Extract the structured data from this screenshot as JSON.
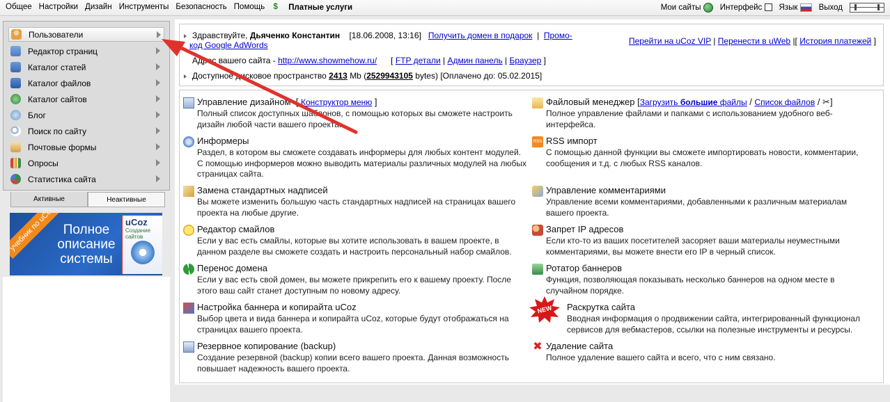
{
  "topbar": {
    "menu": [
      "Общее",
      "Настройки",
      "Дизайн",
      "Инструменты",
      "Безопасность",
      "Помощь"
    ],
    "paid_label": "Платные услуги",
    "right": {
      "my_sites": "Мои сайты",
      "interface": "Интерфейс",
      "language": "Язык",
      "logout": "Выход"
    }
  },
  "sidebar": {
    "items": [
      {
        "label": "Пользователи",
        "icon": "user-icon",
        "color": "#e8a040"
      },
      {
        "label": "Редактор страниц",
        "icon": "page-editor-icon",
        "color": "#4a7ac8"
      },
      {
        "label": "Каталог статей",
        "icon": "articles-icon",
        "color": "#3a6ab0"
      },
      {
        "label": "Каталог файлов",
        "icon": "files-icon",
        "color": "#2a5aa8"
      },
      {
        "label": "Каталог сайтов",
        "icon": "sites-icon",
        "color": "#2e8a3a"
      },
      {
        "label": "Блог",
        "icon": "blog-icon",
        "color": "#6a9ad0"
      },
      {
        "label": "Поиск по сайту",
        "icon": "search-icon",
        "color": "#7a9ac8"
      },
      {
        "label": "Почтовые формы",
        "icon": "mail-icon",
        "color": "#d8a040"
      },
      {
        "label": "Опросы",
        "icon": "poll-icon",
        "color": "#c84a3a"
      },
      {
        "label": "Статистика сайта",
        "icon": "stats-icon",
        "color": "#3a8a4a"
      }
    ],
    "tabs": {
      "active": "Активные",
      "inactive": "Неактивные"
    },
    "banner": {
      "ribbon": "учебник по uCoz",
      "line1": "Полное",
      "line2": "описание",
      "line3": "системы",
      "brand": "uCoz",
      "brand_sub": "Создание сайтов"
    }
  },
  "info": {
    "greeting": "Здравствуйте,",
    "username": "Дьяченко Константин",
    "datetime": "[18.06.2008, 13:16]",
    "domain_gift": "Получить домен в подарок",
    "promo1": "Промо-",
    "promo2": "код Google AdWords",
    "address_label": "Адрес вашего сайта -",
    "address_url": "http://www.showmehow.ru/",
    "ftp": "FTP детали",
    "admin": "Админ панель",
    "browser": "Браузер",
    "disk_label": "Доступное дисковое пространство",
    "disk_mb": "2413",
    "mb": "Mb",
    "disk_bytes": "2529943105",
    "bytes": "bytes",
    "paid_until": "[Оплачено до: 05.02.2015]",
    "vip": "Перейти на uCoz VIP",
    "transfer": "Перенести в uWeb",
    "history": "История платежей"
  },
  "modules_left": [
    {
      "title": "Управление дизайном",
      "link": "Конструктор меню",
      "desc": "Полный список доступных шаблонов, с помощью которых вы сможете настроить дизайн любой части вашего проекта.",
      "icon": "design-icon"
    },
    {
      "title": "Информеры",
      "desc": "Раздел, в котором вы сможете создавать информеры для любых контент модулей. С помощью информеров можно выводить материалы различных модулей на любых страницах сайта.",
      "icon": "informer-icon"
    },
    {
      "title": "Замена стандартных надписей",
      "desc": "Вы можете изменить большую часть стандартных надписей на страницах вашего проекта на любые другие.",
      "icon": "replace-text-icon"
    },
    {
      "title": "Редактор смайлов",
      "desc": "Если у вас есть смайлы, которые вы хотите использовать в вашем проекте, в данном разделе вы сможете создать и настроить персональный набор смайлов.",
      "icon": "smiley-icon"
    },
    {
      "title": "Перенос домена",
      "desc": "Если у вас есть свой домен, вы можете прикрепить его к вашему проекту. После этого ваш сайт станет доступным по новому адресу.",
      "icon": "domain-transfer-icon"
    },
    {
      "title": "Настройка баннера и копирайта uCoz",
      "desc": "Выбор цвета и вида баннера и копирайта uCoz, которые будут отображаться на страницах вашего проекта.",
      "icon": "banner-settings-icon"
    },
    {
      "title": "Резервное копирование (backup)",
      "desc": "Создание резервной (backup) копии всего вашего проекта. Данная возможность повышает надежность вашего проекта.",
      "icon": "backup-icon"
    }
  ],
  "modules_right": [
    {
      "title": "Файловый менеджер",
      "desc": "Полное управление файлами и папками с использованием удобного веб-интерфейса.",
      "icon": "folder-icon"
    },
    {
      "title": "RSS импорт",
      "desc": "С помощью данной функции вы сможете импортировать новости, комментарии, сообщения и т.д. с любых RSS каналов.",
      "icon": "rss-icon"
    },
    {
      "title": "Управление комментариями",
      "desc": "Управление всеми комментариями, добавленными к различным материалам вашего проекта.",
      "icon": "comments-icon"
    },
    {
      "title": "Запрет IP адресов",
      "desc": "Если кто-то из ваших посетителей засоряет ваши материалы неуместными комментариями, вы можете внести его IP в черный список.",
      "icon": "ip-ban-icon"
    },
    {
      "title": "Ротатор баннеров",
      "desc": "Функция, позволяющая показывать несколько баннеров на одном месте в случайном порядке.",
      "icon": "banner-rotator-icon"
    },
    {
      "title": "Раскрутка сайта",
      "desc": "Вводная информация о продвижении сайта, интегрированный функционал сервисов для вебмастеров, ссылки на полезные инструменты и ресурсы.",
      "icon": "new-badge-icon",
      "badge": "NEW"
    },
    {
      "title": "Удаление сайта",
      "desc": "Полное удаление вашего сайта и всего, что с ним связано.",
      "icon": "delete-icon"
    }
  ],
  "file_manager_links": {
    "open": "[",
    "upload": "Загрузить",
    "big": "большие",
    "files": "файлы",
    "sep": "/",
    "list": "Список файлов",
    "close": "]"
  }
}
